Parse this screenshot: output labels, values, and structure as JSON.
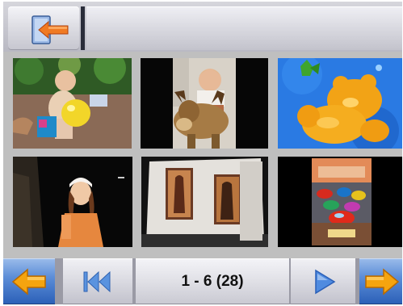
{
  "pager": {
    "range_label": "1 - 6 (28)"
  },
  "icons": {
    "back": "back-arrow-icon",
    "first": "skip-to-first-icon",
    "play": "play-icon",
    "prev": "previous-arrow-icon",
    "next": "next-arrow-icon"
  },
  "thumbnails": [
    {
      "name": "photo-toddler-with-yellow-balloon"
    },
    {
      "name": "photo-toddler-on-toy-moose"
    },
    {
      "name": "photo-orange-gummy-bear"
    },
    {
      "name": "photo-girl-in-orange-shirt"
    },
    {
      "name": "photo-room-with-two-paintings"
    },
    {
      "name": "photo-cars-movie-poster"
    }
  ],
  "colors": {
    "accent_blue": "#3b6fc4",
    "arrow_orange": "#f5a40f",
    "arrow_red": "#e0301d"
  }
}
